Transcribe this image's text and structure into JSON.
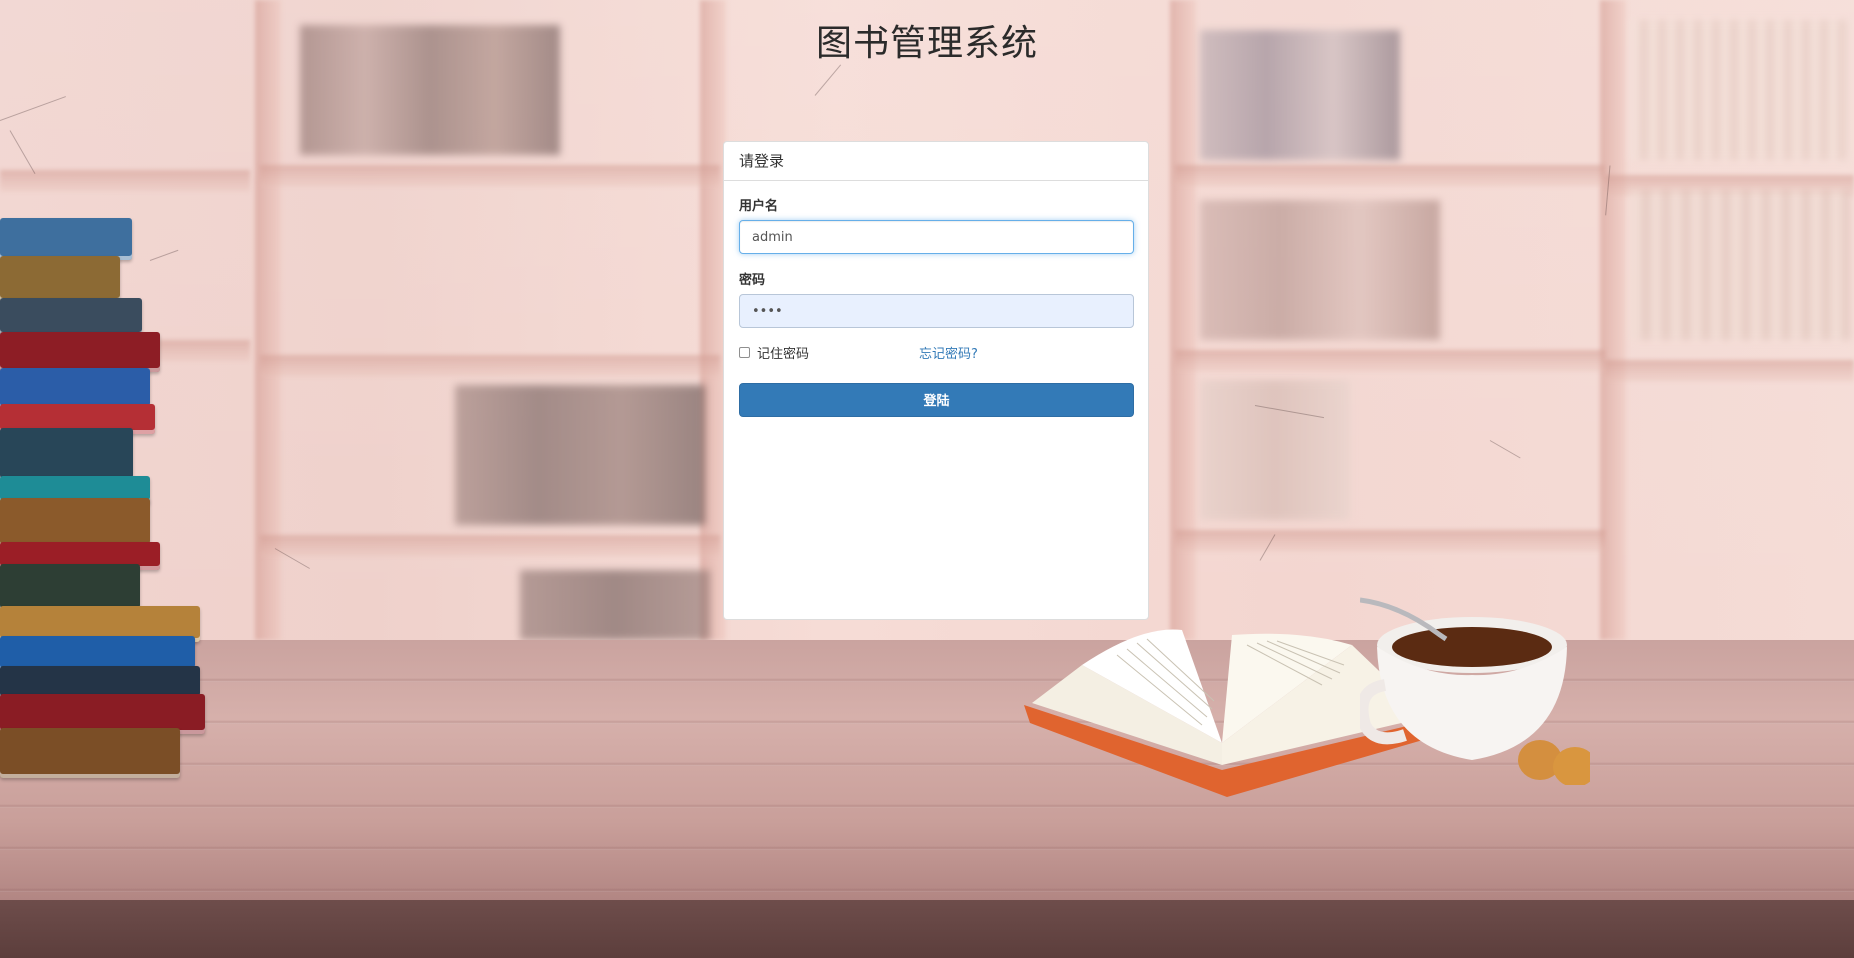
{
  "page": {
    "title": "图书管理系统"
  },
  "login_panel": {
    "heading": "请登录",
    "username": {
      "label": "用户名",
      "value": "admin"
    },
    "password": {
      "label": "密码",
      "masked_value": "••••"
    },
    "remember_label": "记住密码",
    "remember_checked": false,
    "forgot_link": "忘记密码?",
    "submit_label": "登陆"
  },
  "colors": {
    "primary_button": "#337ab7",
    "link": "#337ab7",
    "focus_border": "#66afe9",
    "autofill_bg": "#e8f0fe"
  },
  "icons": {
    "checkbox": "checkbox-unchecked-icon"
  }
}
